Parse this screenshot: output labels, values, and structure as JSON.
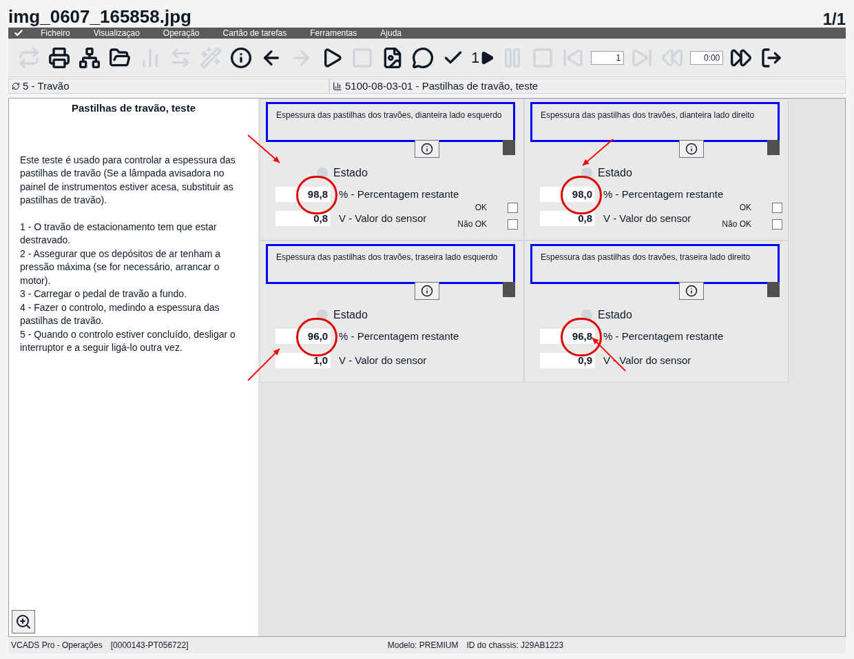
{
  "print_header": {
    "file_name": "img_0607_165858.jpg",
    "page": "1/1"
  },
  "menu": [
    "Ficheiro",
    "Visualizaçao",
    "Operação",
    "Cartão de tarefas",
    "Ferramentas",
    "Ajuda"
  ],
  "toolbar": [
    {
      "kind": "button",
      "disabled": true
    },
    {
      "kind": "button",
      "disabled": false
    },
    {
      "kind": "button",
      "disabled": false
    },
    {
      "kind": "button",
      "disabled": false
    },
    {
      "kind": "button",
      "disabled": true
    },
    {
      "kind": "button",
      "disabled": true
    },
    {
      "kind": "button",
      "disabled": true
    },
    {
      "kind": "button",
      "disabled": false
    },
    {
      "kind": "button",
      "disabled": false
    },
    {
      "kind": "button",
      "disabled": true
    },
    {
      "kind": "button",
      "disabled": false
    },
    {
      "kind": "button",
      "disabled": true
    },
    {
      "kind": "button",
      "disabled": false
    },
    {
      "kind": "button",
      "disabled": false
    },
    {
      "kind": "button",
      "disabled": false
    },
    {
      "kind": "step",
      "label": "1",
      "disabled": false
    },
    {
      "kind": "button",
      "disabled": true
    },
    {
      "kind": "button",
      "disabled": true
    },
    {
      "kind": "button",
      "disabled": true
    },
    {
      "kind": "field",
      "value": "1"
    },
    {
      "kind": "button",
      "disabled": true
    },
    {
      "kind": "button",
      "disabled": true
    },
    {
      "kind": "field",
      "value": "0:00"
    },
    {
      "kind": "button",
      "disabled": false
    },
    {
      "kind": "button",
      "disabled": false
    }
  ],
  "location": {
    "group": "5 - Travão",
    "operation": "5100-08-03-01 - Pastilhas de travão, teste"
  },
  "instructions": {
    "title": "Pastilhas de travão, teste",
    "paragraphs": [
      "Este teste é usado para controlar a espessura das pastilhas de travão (Se a lâmpada avisadora no painel de instrumentos estiver acesa, substituir as pastilhas de travão).",
      "1 - O travão de estacionamento tem que estar destravado.",
      "2 - Assegurar que os depósitos de ar tenham a pressão máxima (se for necessário, arrancar o motor).",
      "3 - Carregar o pedal de travão a fundo.",
      "4 - Fazer o controlo, medindo a espessura das pastilhas de travão.",
      "5 - Quando o controlo estiver concluído, desligar o interruptor e a seguir ligá-lo outra vez."
    ]
  },
  "measurements": [
    {
      "title": "Espessura das pastilhas dos travões, dianteira lado esquerdo",
      "highlighted": true,
      "status": "Estado",
      "percent": "98,8",
      "percent_label": "% - Percentagem restante",
      "percent_circled": true,
      "sensor": "0,8",
      "sensor_label": "V - Valor do sensor",
      "arrow": {
        "kind": "from-top-left"
      },
      "checks": [
        {
          "label": "OK",
          "checked": false
        },
        {
          "label": "Não OK",
          "checked": false
        }
      ]
    },
    {
      "title": "Espessura das pastilhas dos travões, dianteira lado direito",
      "highlighted": true,
      "status": "Estado",
      "percent": "98,0",
      "percent_label": "% - Percentagem restante",
      "percent_circled": true,
      "sensor": "0,8",
      "sensor_label": "V - Valor do sensor",
      "arrow": {
        "kind": "from-top-right"
      },
      "checks": [
        {
          "label": "OK",
          "checked": false
        },
        {
          "label": "Não OK",
          "checked": false
        }
      ]
    },
    {
      "title": "Espessura das pastilhas dos travões, traseira lado esquerdo",
      "highlighted": true,
      "status": "Estado",
      "percent": "96,0",
      "percent_label": "% - Percentagem restante",
      "percent_circled": true,
      "sensor": "1,0",
      "sensor_label": "V - Valor do sensor",
      "arrow": {
        "kind": "from-bottom-left"
      }
    },
    {
      "title": "Espessura das pastilhas dos travões, traseira lado direito",
      "highlighted": true,
      "status": "Estado",
      "percent": "96,8",
      "percent_label": "% - Percentagem restante",
      "percent_circled": true,
      "sensor": "0,9",
      "sensor_label": "V - Valor do sensor",
      "arrow": {
        "kind": "from-bottom-right"
      }
    }
  ],
  "status_bar": {
    "app": "VCADS Pro - Operações",
    "order": "[0000143-PT056722]",
    "model": "Modelo: PREMIUM",
    "chassis": "ID do chassis: J29AB1223"
  }
}
